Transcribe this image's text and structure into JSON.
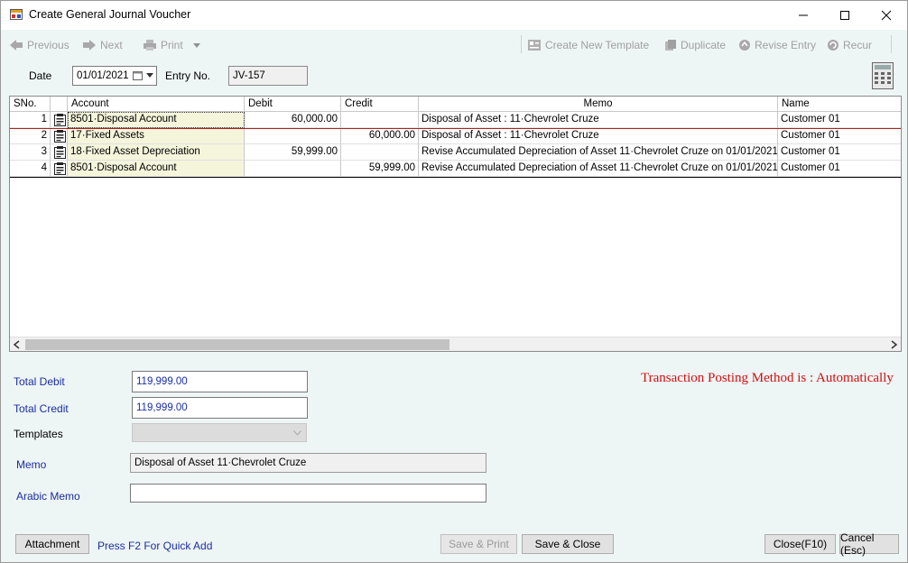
{
  "window": {
    "title": "Create General Journal Voucher"
  },
  "toolbar": {
    "previous": "Previous",
    "next": "Next",
    "print": "Print",
    "create_template": "Create New Template",
    "duplicate": "Duplicate",
    "revise_entry": "Revise Entry",
    "recur": "Recur"
  },
  "header": {
    "date_label": "Date",
    "date_value": "01/01/2021",
    "entry_label": "Entry No.",
    "entry_value": "JV-157"
  },
  "grid": {
    "columns": {
      "sno": "SNo.",
      "account": "Account",
      "debit": "Debit",
      "credit": "Credit",
      "memo": "Memo",
      "name": "Name"
    },
    "rows": [
      {
        "sno": "1",
        "account": "8501·Disposal Account",
        "debit": "60,000.00",
        "credit": "",
        "memo": "Disposal of Asset : 11·Chevrolet Cruze",
        "name": "Customer 01"
      },
      {
        "sno": "2",
        "account": "17·Fixed Assets",
        "debit": "",
        "credit": "60,000.00",
        "memo": "Disposal of Asset : 11·Chevrolet Cruze",
        "name": "Customer 01"
      },
      {
        "sno": "3",
        "account": "18·Fixed Asset Depreciation",
        "debit": "59,999.00",
        "credit": "",
        "memo": "Revise Accumulated Depreciation of Asset 11·Chevrolet Cruze on 01/01/2021",
        "name": "Customer 01"
      },
      {
        "sno": "4",
        "account": "8501·Disposal Account",
        "debit": "",
        "credit": "59,999.00",
        "memo": "Revise Accumulated Depreciation of Asset 11·Chevrolet Cruze on 01/01/2021",
        "name": "Customer 01"
      }
    ]
  },
  "footer": {
    "total_debit_label": "Total Debit",
    "total_debit_value": "119,999.00",
    "total_credit_label": "Total Credit",
    "total_credit_value": "119,999.00",
    "templates_label": "Templates",
    "posting_method": "Transaction Posting Method is : Automatically",
    "memo_label": "Memo",
    "memo_value": "Disposal of Asset 11·Chevrolet Cruze",
    "arabic_memo_label": "Arabic Memo",
    "arabic_memo_value": ""
  },
  "buttons": {
    "attachment": "Attachment",
    "quick_add_hint": "Press F2 For Quick Add",
    "save_print": "Save & Print",
    "save_close": "Save & Close",
    "close": "Close(F10)",
    "cancel": "Cancel (Esc)"
  },
  "colors": {
    "accent_blue": "#1a2ea0",
    "posting_red": "#d01010",
    "account_cell_bg": "#f5f5dc"
  }
}
